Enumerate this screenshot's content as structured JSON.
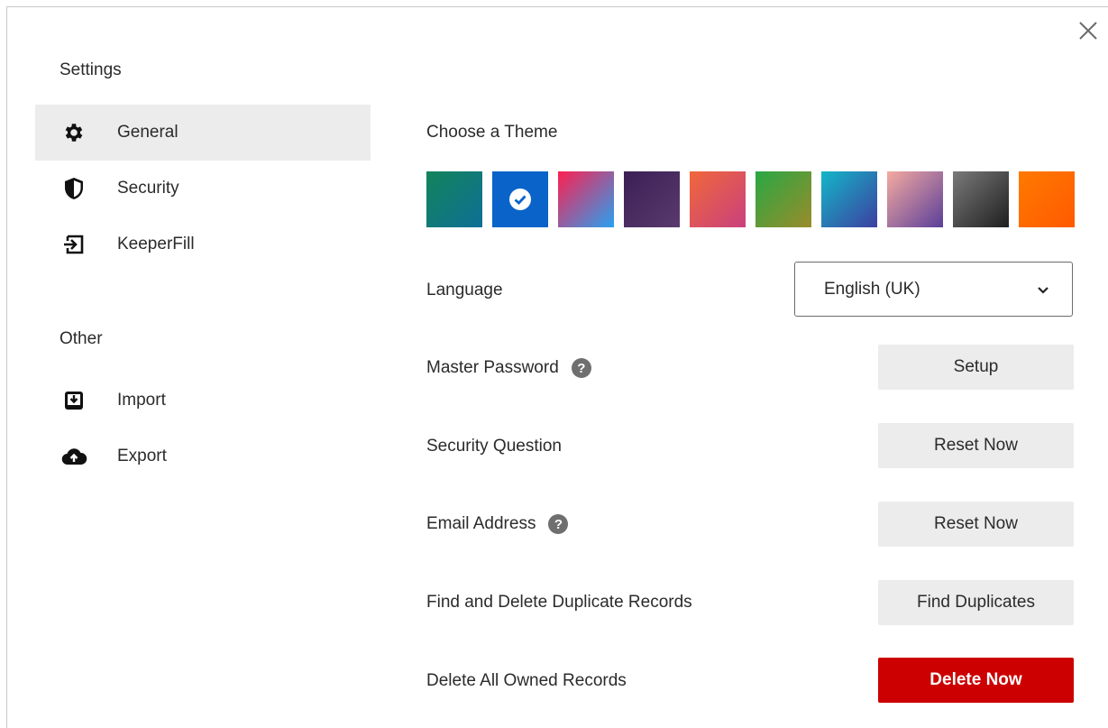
{
  "sidebar": {
    "settings_title": "Settings",
    "settings_items": [
      {
        "label": "General",
        "icon": "gear-icon",
        "active": true
      },
      {
        "label": "Security",
        "icon": "shield-icon",
        "active": false
      },
      {
        "label": "KeeperFill",
        "icon": "keeperfill-icon",
        "active": false
      }
    ],
    "other_title": "Other",
    "other_items": [
      {
        "label": "Import",
        "icon": "import-icon"
      },
      {
        "label": "Export",
        "icon": "cloud-upload-icon"
      }
    ]
  },
  "main": {
    "theme_title": "Choose a Theme",
    "themes": [
      {
        "name": "green-teal",
        "from": "#12845b",
        "to": "#0e6f96"
      },
      {
        "name": "blue",
        "from": "#0a63c9",
        "to": "#0a63c9",
        "selected": true
      },
      {
        "name": "pink-blue",
        "from": "#ff1f4f",
        "to": "#27a1f2"
      },
      {
        "name": "purple",
        "from": "#3b1f55",
        "to": "#5a3a6e"
      },
      {
        "name": "coral",
        "from": "#f0683a",
        "to": "#c9407e"
      },
      {
        "name": "green-olive",
        "from": "#27a844",
        "to": "#9b8b2a"
      },
      {
        "name": "cyan-indigo",
        "from": "#13b6c8",
        "to": "#3d3fa0"
      },
      {
        "name": "peach-purple",
        "from": "#f5aaa0",
        "to": "#5a3f9a"
      },
      {
        "name": "gray",
        "from": "#7a7a7a",
        "to": "#1f1f1f"
      },
      {
        "name": "orange",
        "from": "#ff7a00",
        "to": "#ff5a00"
      }
    ],
    "language": {
      "label": "Language",
      "value": "English (UK)"
    },
    "master_password": {
      "label": "Master Password",
      "button": "Setup"
    },
    "security_question": {
      "label": "Security Question",
      "button": "Reset Now"
    },
    "email_address": {
      "label": "Email Address",
      "button": "Reset Now"
    },
    "duplicates": {
      "label": "Find and Delete Duplicate Records",
      "button": "Find Duplicates"
    },
    "delete_all": {
      "label": "Delete All Owned Records",
      "button": "Delete Now"
    }
  },
  "colors": {
    "accent_danger": "#cc0000",
    "active_nav_bg": "#ececec",
    "button_bg": "#ececec"
  }
}
